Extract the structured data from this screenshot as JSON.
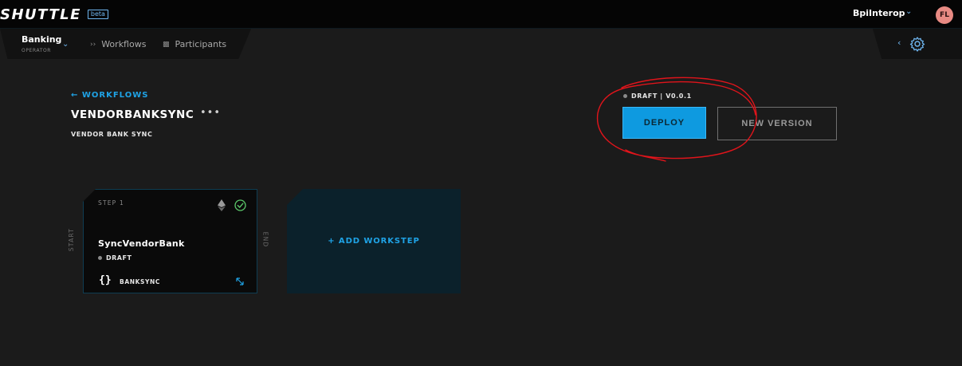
{
  "topbar": {
    "logo": "SHUTTLE",
    "beta_badge": "beta",
    "org_name": "BpiInterop",
    "avatar_initials": "FL"
  },
  "nav": {
    "context_title": "Banking",
    "context_subtitle": "OPERATOR",
    "items": [
      {
        "label": "Workflows",
        "icon": "double-chevron-icon"
      },
      {
        "label": "Participants",
        "icon": "participants-icon"
      }
    ]
  },
  "workflow": {
    "back_link": "WORKFLOWS",
    "title": "VENDORBANKSYNC",
    "subtitle": "VENDOR BANK SYNC",
    "status": "DRAFT | V0.0.1",
    "deploy_label": "DEPLOY",
    "new_version_label": "NEW VERSION"
  },
  "canvas": {
    "start_label": "START",
    "end_label": "END",
    "step": {
      "number_label": "STEP 1",
      "name": "SyncVendorBank",
      "status": "DRAFT",
      "type_label": "BANKSYNC"
    },
    "add_label": "+ ADD WORKSTEP"
  },
  "colors": {
    "accent": "#1fa3e6",
    "deploy_button": "#0e9ae0",
    "check_green": "#5bc86a",
    "annotation_red": "#e0141b"
  }
}
